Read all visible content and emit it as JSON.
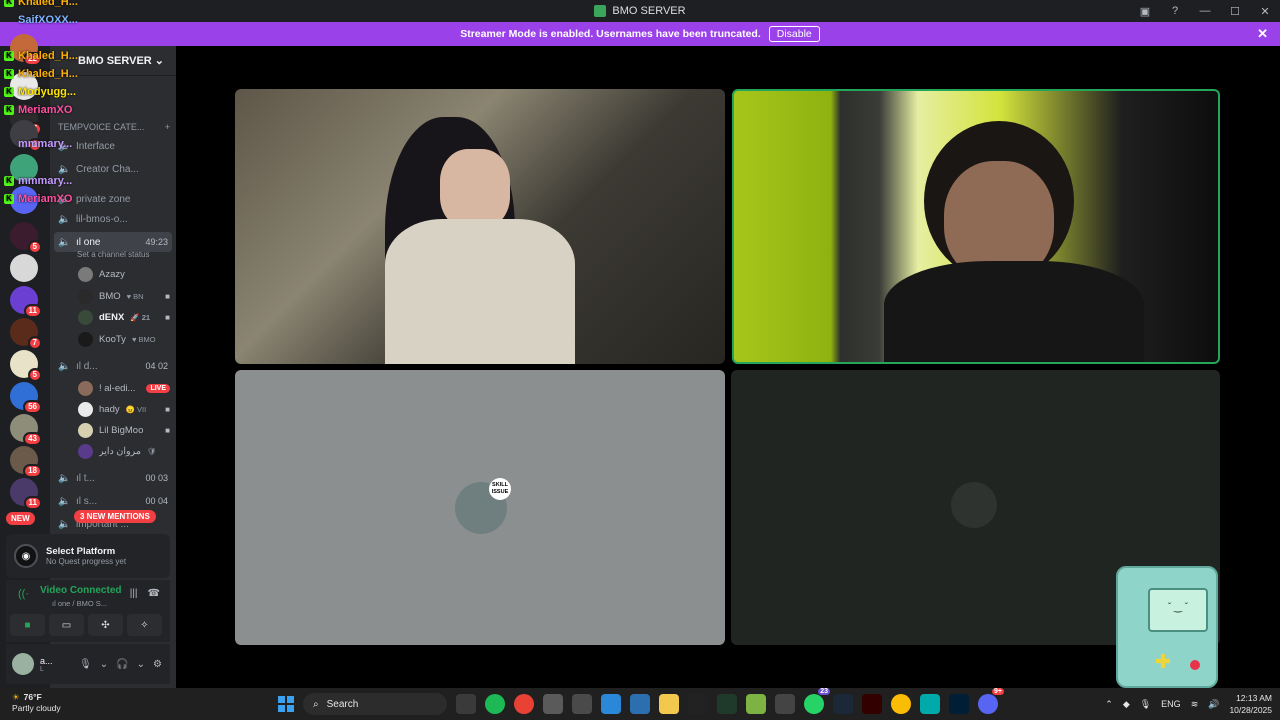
{
  "window": {
    "title": "BMO SERVER",
    "controls": [
      "▣",
      "?",
      "—",
      "☐",
      "✕"
    ]
  },
  "banner": {
    "message": "Streamer Mode is enabled. Usernames have been truncated.",
    "disable_label": "Disable",
    "close": "✕",
    "color": "#9b41ea"
  },
  "rail": {
    "badges": [
      "22",
      "7",
      "1",
      "5",
      "11",
      "7",
      "5",
      "56",
      "43",
      "18",
      "11"
    ],
    "new_label": "NEW"
  },
  "sidebar": {
    "server_name": "BMO SERVER",
    "server_chevron": "⌄",
    "category": "TEMPVOICE CATE...",
    "category_add": "+",
    "channels": [
      {
        "label": "Interface",
        "icon": "speaker"
      },
      {
        "label": "Creator Cha...",
        "icon": "plus"
      },
      {
        "label": "private zone",
        "icon": "lock"
      },
      {
        "label": "lil-bmos-o...",
        "icon": "fire"
      },
      {
        "label": "ıl one",
        "timer": "49:23",
        "active": true
      },
      {
        "label": "ıl d...",
        "timer": "04  02"
      },
      {
        "label": "ıl t...",
        "timer": "00  03"
      },
      {
        "label": "ıl s...",
        "timer": "00  04"
      },
      {
        "label": "important ...",
        "icon": "speaker"
      }
    ],
    "channel_status": "Set a channel status",
    "one_users": [
      {
        "name": "Azazy",
        "tag": ""
      },
      {
        "name": "BMO",
        "tag": "♥ BN"
      },
      {
        "name": "dENX",
        "tag": "🚀 21"
      },
      {
        "name": "KooTy",
        "tag": "♥ BMO"
      }
    ],
    "d_users": [
      {
        "name": "! al-edi...",
        "tag": "",
        "live": "LIVE"
      },
      {
        "name": "hady",
        "tag": "😠 VII"
      },
      {
        "name": "Lil BigMoo",
        "tag": ""
      },
      {
        "name": "مروان داير",
        "tag": "🛡"
      }
    ],
    "mentions_label": "3 NEW MENTIONS"
  },
  "quest": {
    "title": "Select Platform",
    "subtitle": "No Quest progress yet"
  },
  "voice": {
    "status": "Video Connected",
    "channel": "ıl one / BMO S..."
  },
  "user": {
    "name": "a...",
    "sub": "L"
  },
  "overlay_chat": [
    {
      "name": "Khaled_H...",
      "color": "#ffb000",
      "kick": true
    },
    {
      "name": "SaifXOXX...",
      "color": "#7fb3ff",
      "kick": false
    },
    {
      "name": "Khaled_H...",
      "color": "#ffb000",
      "kick": true
    },
    {
      "name": "Khaled_H...",
      "color": "#ffb000",
      "kick": true
    },
    {
      "name": "Modyugg...",
      "color": "#ffe600",
      "kick": true
    },
    {
      "name": "MeriamXO",
      "color": "#ff4fa0",
      "kick": true
    },
    {
      "name": "mmmary...",
      "color": "#c49bff",
      "kick": false
    },
    {
      "name": "mmmary...",
      "color": "#c49bff",
      "kick": true
    },
    {
      "name": "MeriamXO",
      "color": "#ff4fa0",
      "kick": true
    }
  ],
  "stage": {
    "grey_tile_badge": "SKILL ISSUE",
    "active_border": "#23a55a"
  },
  "taskbar": {
    "weather_temp": "76°F",
    "weather_desc": "Partly cloudy",
    "weather_badge": "2",
    "search_label": "Search",
    "language": "ENG",
    "time": "12:13 AM",
    "date": "10/28/2025",
    "app_badges": [
      "23",
      "9+"
    ]
  }
}
